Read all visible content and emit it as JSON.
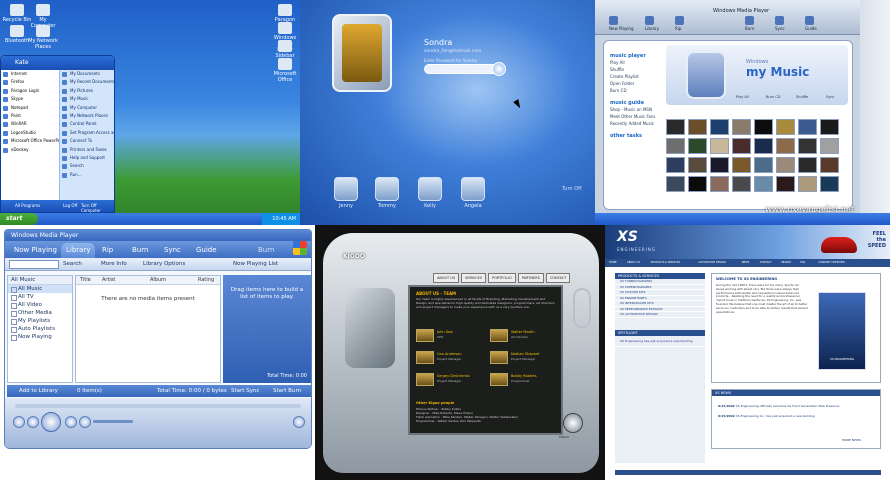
{
  "p1": {
    "desktop_icons": [
      {
        "label": "Recycle Bin"
      },
      {
        "label": "My Computer"
      },
      {
        "label": "Bluetooth"
      },
      {
        "label": "My Network Places"
      },
      {
        "label": "Paragon Login"
      },
      {
        "label": "Windows Media Player"
      },
      {
        "label": "Sidebar"
      },
      {
        "label": "Microsoft Office"
      }
    ],
    "start_menu": {
      "user": "Kate",
      "left_items": [
        "Internet",
        "Firefox",
        "Paragon Login",
        "Skype",
        "Notepad",
        "Paint",
        "WinRAR",
        "LogonStudio",
        "Microsoft Office PowerPoint 2003",
        "eDonkey"
      ],
      "right_items": [
        "My Documents",
        "My Recent Documents",
        "My Pictures",
        "My Music",
        "My Computer",
        "My Network Places",
        "Control Panel",
        "Set Program Access and Defaults",
        "Connect To",
        "Printers and Faxes",
        "Help and Support",
        "Search",
        "Run..."
      ],
      "all_programs": "All Programs",
      "log_off": "Log Off",
      "turn_off": "Turn Off Computer"
    },
    "taskbar": {
      "start_label": "start",
      "clock": "10:45 AM"
    }
  },
  "p2": {
    "name": "Sondra",
    "email": "sondra_fan@hotmail.com",
    "password_label": "Enter Password for Sondra",
    "users": [
      "Jenny",
      "Tommy",
      "Kelly",
      "Angela"
    ],
    "turn_off": "Turn Off"
  },
  "p3": {
    "title": "Windows Media Player",
    "nav": [
      "Now Playing",
      "Library",
      "Rip",
      "Burn",
      "Sync",
      "Guide"
    ],
    "logo_small": "Windows",
    "logo": "my Music",
    "left_sections": [
      {
        "head": "music player",
        "items": [
          "Play All",
          "Shuffle",
          "Create Playlist",
          "Open Folder",
          "Burn CD"
        ]
      },
      {
        "head": "music guide",
        "items": [
          "Shop - Music on MSN",
          "Meet Other Music Fans",
          "Recently Added Music"
        ]
      },
      {
        "head": "other tasks",
        "items": []
      }
    ],
    "device_labels": [
      "Play All",
      "Burn CD",
      "Shuffle",
      "Sync"
    ],
    "watermark": "www.uxevangelist.net",
    "thumb_colors": [
      "#2a2a2a",
      "#6b4f2a",
      "#1d3f6e",
      "#8a7c6b",
      "#0c0c0c",
      "#a88a3c",
      "#3b5a8f",
      "#1a1a1a",
      "#6e6e6e",
      "#2c4a2a",
      "#c8b89a",
      "#4a2c2c",
      "#1b2b4b",
      "#8c6a4a",
      "#333",
      "#a0a0a0",
      "#2d3d5d",
      "#5a4a3a",
      "#1a1a2a",
      "#7a5a2a",
      "#4c6c8c",
      "#9a8a7a",
      "#2a2a2a",
      "#5a3a2a",
      "#3a4a5a",
      "#0a0a0a",
      "#8a6a5a",
      "#4a4a4a",
      "#6a8aaa",
      "#2a1a1a",
      "#aa9a7a",
      "#1a3a5a"
    ]
  },
  "p4": {
    "title": "Windows Media Player",
    "tabs": [
      "Now Playing",
      "Library",
      "Rip",
      "Burn",
      "Sync",
      "Guide",
      "Burn"
    ],
    "toolbar": {
      "search": "Search",
      "more_info": "More Info",
      "library_options": "Library Options",
      "now_playing_list": "Now Playing List"
    },
    "tree_head": "All Music",
    "tree": [
      "All Music",
      "All TV",
      "All Video",
      "Other Media",
      "My Playlists",
      "Auto Playlists",
      "Now Playing"
    ],
    "columns": [
      "Title",
      "Artist",
      "Album",
      "Rating"
    ],
    "empty": "There are no media items present",
    "np_hint": "Drag items here to build a list of items to play.",
    "np_total": "Total Time: 0:00",
    "status": {
      "add": "Add to Library",
      "items": "0 Item(s)",
      "total": "Total Time: 0:00 / 0 bytes",
      "sync": "Start Sync",
      "burn": "Start Burn"
    }
  },
  "p5": {
    "logo": "KIGOO",
    "nav": [
      "ABOUT US",
      "SERVICES",
      "PORTFOLIO",
      "PARTNERS",
      "CONTACT"
    ],
    "about_title": "ABOUT US - TEAM",
    "about_text": "Our team is highly experienced in all facets of Branding, Marketing, Development and Design, and specialized in high quality and dedicated designers, programmers, art directors and project managers to make your experience with us a very positive one.",
    "members": [
      {
        "name": "John Doe",
        "role": "CEO"
      },
      {
        "name": "Walter Martin",
        "role": "Art Director"
      },
      {
        "name": "Lisa Anderson",
        "role": "Project Manager"
      },
      {
        "name": "Nathan Shepard",
        "role": "Project Manager"
      },
      {
        "name": "Sergey Dmitrienko",
        "role": "Project Manager"
      },
      {
        "name": "Bobby Roberts",
        "role": "Programmer"
      }
    ],
    "other_title": "Other Kigoo people",
    "other_list": [
      "Phocus Partner - Bobby Kidlos",
      "Designer - Mike Roberts, Steve Pinkus",
      "Flash animation - Mike Kanden, Walter Obregon, Walter Valdesoleiro",
      "Programmer - Walter Santos, Ron Mesquita"
    ],
    "footer": "KIGOO"
  },
  "p6": {
    "logo": "XS",
    "sub": "ENGINEERING",
    "tag": [
      "FEEL",
      "the",
      "SPEED"
    ],
    "nav": [
      "HOME",
      "ABOUT US",
      "PRODUCTS & SERVICES",
      "AUTOMOTIVE DESIGN",
      "NEWS",
      "CONTACT",
      "SEARCH",
      "FAQ",
      "COMPANY OVERVIEW"
    ],
    "products_head": "PRODUCTS & SERVICES",
    "products": [
      "XS TURBOCHARGERS",
      "XS SUPERCHARGERS",
      "XS CUSTOM KITS",
      "XS ENGINE PARTS",
      "XS INTERCOOLER KITS",
      "XS PERFORMANCE EXHAUST",
      "XS AUTOMOTIVE DESIGN"
    ],
    "spotlight_head": "SPOTLIGHT",
    "spotlight_text": "XS Engineering has just acquired a new building",
    "welcome_title": "WELCOME TO XS ENGINEERING",
    "welcome_body": "During the mid 1990's, there were far too many 'sports car' shops working with street cars. But there were always high performance enthusiasts who requested unusual advanced products... Realizing the need for a quality and professional import tuner in Southern California, XS Engineering, Inc. was founded. We believe that one must master the art of all to better serve our customers and to be able to deliver results that exceed expectations.",
    "photo_label": "XS ENGINEERING",
    "news_head": "XS NEWS",
    "news": [
      {
        "date": "8/15/2002",
        "text": "XS Engineering officially launches its Third Generation Web Presence"
      },
      {
        "date": "8/15/2002",
        "text": "XS Engineering Inc. has just acquired a new building"
      }
    ],
    "more_news": "MORE NEWS"
  }
}
